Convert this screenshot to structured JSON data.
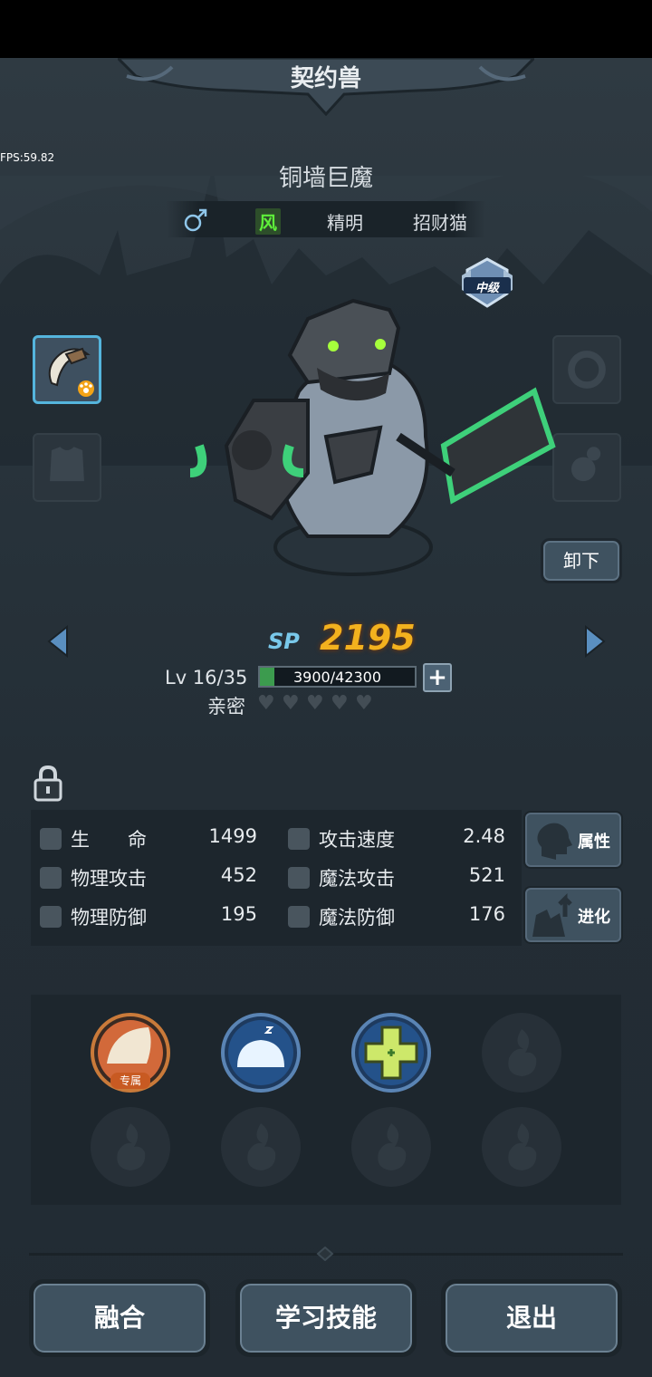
{
  "fps": "FPS:59.82",
  "header": {
    "title": "契约兽"
  },
  "pet": {
    "name": "铜墙巨魔",
    "gender_icon": "male-symbol-icon",
    "gender_symbol": "♂",
    "element": "风",
    "personality": "精明",
    "trait": "招财猫",
    "rank": "中级"
  },
  "equipment": {
    "unequip_label": "卸下",
    "slots": [
      "fang-claw-icon",
      "armor-empty-icon",
      "ring-empty-icon",
      "accessory-empty-icon"
    ]
  },
  "progress": {
    "sp_label": "SP",
    "sp_value": "2195",
    "level_text": "Lv 16/35",
    "xp_text": "3900/42300",
    "xp_current": 3900,
    "xp_max": 42300,
    "intimacy_label": "亲密",
    "intimacy_hearts_filled": 0,
    "intimacy_hearts_total": 5
  },
  "stats": {
    "hp_label": "生　　命",
    "hp_value": "1499",
    "atk_speed_label": "攻击速度",
    "atk_speed_value": "2.48",
    "phys_atk_label": "物理攻击",
    "phys_atk_value": "452",
    "magic_atk_label": "魔法攻击",
    "magic_atk_value": "521",
    "phys_def_label": "物理防御",
    "phys_def_value": "195",
    "magic_def_label": "魔法防御",
    "magic_def_value": "176"
  },
  "side_buttons": {
    "attributes_label": "属性",
    "evolve_label": "进化"
  },
  "skills": {
    "exclusive_tag": "专属",
    "slots": [
      "exclusive-slash-skill-icon",
      "sleep-dome-skill-icon",
      "heal-cross-skill-icon",
      "empty",
      "empty",
      "empty",
      "empty",
      "empty"
    ]
  },
  "bottom": {
    "fuse_label": "融合",
    "learn_label": "学习技能",
    "exit_label": "退出"
  },
  "colors": {
    "sp": "#f3b11e",
    "element": "#5ef03a",
    "accent_blue": "#55b5dd"
  }
}
